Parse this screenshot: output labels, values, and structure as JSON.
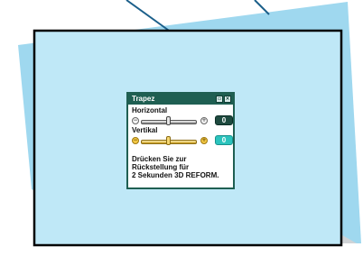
{
  "dialog": {
    "title": "Trapez",
    "title_icons": [
      "minimize-icon",
      "close-icon"
    ]
  },
  "horizontal": {
    "label": "Horizontal",
    "value": "0",
    "position": 0.5,
    "highlighted": false
  },
  "vertical": {
    "label": "Vertikal",
    "value": "0",
    "position": 0.5,
    "highlighted": true
  },
  "instruction": {
    "lines": [
      "Drücken Sie zur",
      "Rückstellung für",
      "2 Sekunden 3D REFORM."
    ]
  },
  "colors": {
    "screen": "#bfe8f7",
    "screen_shadow": "#9fd8ef",
    "gray_shadow": "#cfd3d6",
    "titlebar": "#1f5f52",
    "value_dark": "#1e4a3f",
    "value_highlight": "#2bc3bd",
    "slider_gold": "#f2c744"
  }
}
